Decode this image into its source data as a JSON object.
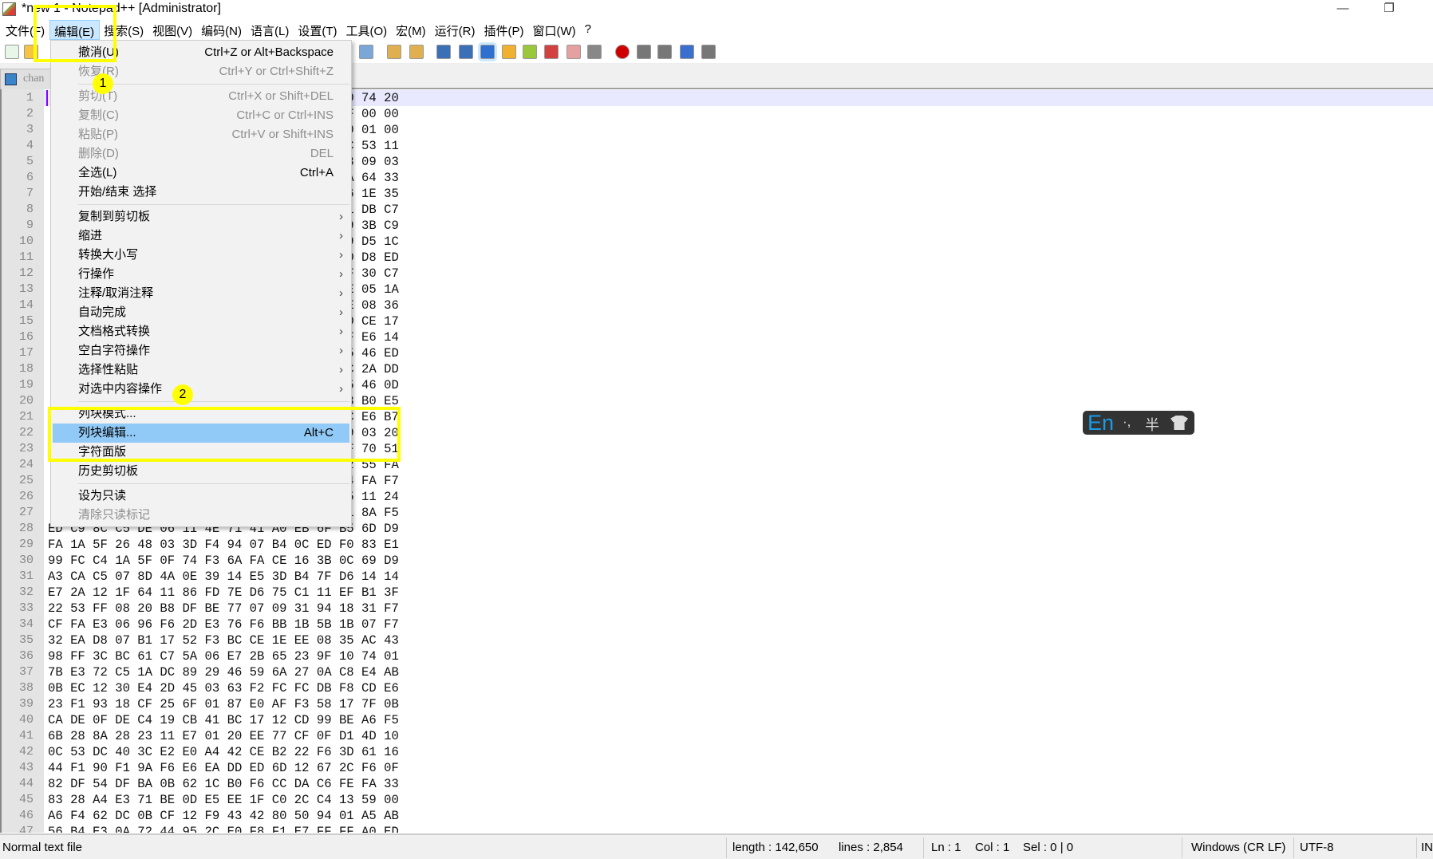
{
  "window": {
    "title": "*new 1 - Notepad++ [Administrator]",
    "minimize": "—",
    "restore": "❐"
  },
  "menubar": [
    "文件(F)",
    "编辑(E)",
    "搜索(S)",
    "视图(V)",
    "编码(N)",
    "语言(L)",
    "设置(T)",
    "工具(O)",
    "宏(M)",
    "运行(R)",
    "插件(P)",
    "窗口(W)",
    "?"
  ],
  "toolbar_icons": [
    {
      "name": "new-file",
      "color": "#e8f5e9"
    },
    {
      "name": "open-file",
      "color": "#f6c343"
    },
    {
      "name": "zoom-out",
      "color": "#7aa7d8"
    },
    {
      "name": "sync-vertical",
      "color": "#e0b050"
    },
    {
      "name": "sync-horizontal",
      "color": "#e0b050"
    },
    {
      "name": "word-wrap",
      "color": "#3b6fb6"
    },
    {
      "name": "show-all-chars",
      "color": "#3b6fb6"
    },
    {
      "name": "indent-guide",
      "color": "#2f6fd0"
    },
    {
      "name": "document-map",
      "color": "#f0b030"
    },
    {
      "name": "function-list",
      "color": "#9bc83b"
    },
    {
      "name": "folder-workspace",
      "color": "#d24040"
    },
    {
      "name": "monitoring",
      "color": "#e5a0a0"
    },
    {
      "name": "record-macro-disabled",
      "color": "#888888"
    },
    {
      "name": "record-macro",
      "color": "#d00000"
    },
    {
      "name": "stop-recording",
      "color": "#777777"
    },
    {
      "name": "play-macro",
      "color": "#777777"
    },
    {
      "name": "run-macro-multiple",
      "color": "#3a6fd0"
    },
    {
      "name": "save-macro",
      "color": "#777777"
    }
  ],
  "tab": {
    "label": "chan"
  },
  "editor": {
    "current_line": 1,
    "rows": [
      {
        "n": "1",
        "hex": "                                       6D 74 20"
      },
      {
        "n": "2",
        "hex": "                                       0F 00 00"
      },
      {
        "n": "3",
        "hex": "                                       00 01 00"
      },
      {
        "n": "4",
        "hex": "                                       0C 53 11"
      },
      {
        "n": "5",
        "hex": "                                       33 09 03"
      },
      {
        "n": "6",
        "hex": "                                       0A 64 33"
      },
      {
        "n": "7",
        "hex": "                                       16 1E 35"
      },
      {
        "n": "8",
        "hex": "                                       11 DB C7"
      },
      {
        "n": "9",
        "hex": "                                       F9 3B C9"
      },
      {
        "n": "10",
        "hex": "                                       09 D5 1C"
      },
      {
        "n": "11",
        "hex": "                                       DD D8 ED"
      },
      {
        "n": "12",
        "hex": "                                       AF 30 C7"
      },
      {
        "n": "13",
        "hex": "                                       0E 05 1A"
      },
      {
        "n": "14",
        "hex": "                                       3E 08 36"
      },
      {
        "n": "15",
        "hex": "                                       ED CE 17"
      },
      {
        "n": "16",
        "hex": "                                       FF E6 14"
      },
      {
        "n": "17",
        "hex": "                                       45 46 ED"
      },
      {
        "n": "18",
        "hex": "                                       0C 2A DD"
      },
      {
        "n": "19",
        "hex": "                                       D5 46 0D"
      },
      {
        "n": "20",
        "hex": "                                       E3 B0 E5"
      },
      {
        "n": "21",
        "hex": "                                       DC E6 B7"
      },
      {
        "n": "22",
        "hex": "                                       F9 03 20"
      },
      {
        "n": "23",
        "hex": "                                       1F 70 51"
      },
      {
        "n": "24",
        "hex": "                                       F2 55 FA"
      },
      {
        "n": "25",
        "hex": "                                       04 FA F7"
      },
      {
        "n": "26",
        "hex": "                                       55 11 24"
      },
      {
        "n": "27",
        "hex": "                                       11 8A F5"
      },
      {
        "n": "28",
        "hex": "ED C9 8C C5 DE 06 11 4E 71 41 A0 EB 6F B5 6D D9"
      },
      {
        "n": "29",
        "hex": "FA 1A 5F 26 48 03 3D F4 94 07 B4 0C ED F0 83 E1"
      },
      {
        "n": "30",
        "hex": "99 FC C4 1A 5F 0F 74 F3 6A FA CE 16 3B 0C 69 D9"
      },
      {
        "n": "31",
        "hex": "A3 CA C5 07 8D 4A 0E 39 14 E5 3D B4 7F D6 14 14"
      },
      {
        "n": "32",
        "hex": "E7 2A 12 1F 64 11 86 FD 7E D6 75 C1 11 EF B1 3F"
      },
      {
        "n": "33",
        "hex": "22 53 FF 08 20 B8 DF BE 77 07 09 31 94 18 31 F7"
      },
      {
        "n": "34",
        "hex": "CF FA E3 06 96 F6 2D E3 76 F6 BB 1B 5B 1B 07 F7"
      },
      {
        "n": "35",
        "hex": "32 EA D8 07 B1 17 52 F3 BC CE 1E EE 08 35 AC 43"
      },
      {
        "n": "36",
        "hex": "98 FF 3C BC 61 C7 5A 06 E7 2B 65 23 9F 10 74 01"
      },
      {
        "n": "37",
        "hex": "7B E3 72 C5 1A DC 89 29 46 59 6A 27 0A C8 E4 AB"
      },
      {
        "n": "38",
        "hex": "0B EC 12 30 E4 2D 45 03 63 F2 FC FC DB F8 CD E6"
      },
      {
        "n": "39",
        "hex": "23 F1 93 18 CF 25 6F 01 87 E0 AF F3 58 17 7F 0B"
      },
      {
        "n": "40",
        "hex": "CA DE 0F DE C4 19 CB 41 BC 17 12 CD 99 BE A6 F5"
      },
      {
        "n": "41",
        "hex": "6B 28 8A 28 23 11 E7 01 20 EE 77 CF 0F D1 4D 10"
      },
      {
        "n": "42",
        "hex": "0C 53 DC 40 3C E2 E0 A4 42 CE B2 22 F6 3D 61 16"
      },
      {
        "n": "43",
        "hex": "44 F1 90 F1 9A F6 E6 EA DD ED 6D 12 67 2C F6 0F"
      },
      {
        "n": "44",
        "hex": "82 DF 54 DF BA 0B 62 1C B0 F6 CC DA C6 FE FA 33"
      },
      {
        "n": "45",
        "hex": "83 28 A4 E3 71 BE 0D E5 EE 1F C0 2C C4 13 59 00"
      },
      {
        "n": "46",
        "hex": "A6 F4 62 DC 0B CF 12 F9 43 42 80 50 94 01 A5 AB"
      },
      {
        "n": "47",
        "hex": "56 B4 E3 0A 72 44 95 2C E0 F8 F1 E7 FF FF A0 ED"
      }
    ]
  },
  "edit_menu": [
    {
      "label": "撤消(U)",
      "shortcut": "Ctrl+Z or Alt+Backspace",
      "disabled": false
    },
    {
      "label": "恢复(R)",
      "shortcut": "Ctrl+Y or Ctrl+Shift+Z",
      "disabled": true
    },
    {
      "sep": true
    },
    {
      "label": "剪切(T)",
      "shortcut": "Ctrl+X or Shift+DEL",
      "disabled": true
    },
    {
      "label": "复制(C)",
      "shortcut": "Ctrl+C or Ctrl+INS",
      "disabled": true
    },
    {
      "label": "粘贴(P)",
      "shortcut": "Ctrl+V or Shift+INS",
      "disabled": true
    },
    {
      "label": "删除(D)",
      "shortcut": "DEL",
      "disabled": true
    },
    {
      "label": "全选(L)",
      "shortcut": "Ctrl+A",
      "disabled": false
    },
    {
      "label": "开始/结束 选择",
      "shortcut": "",
      "disabled": false
    },
    {
      "sep": true
    },
    {
      "label": "复制到剪切板",
      "submenu": true
    },
    {
      "label": "缩进",
      "submenu": true
    },
    {
      "label": "转换大小写",
      "submenu": true
    },
    {
      "label": "行操作",
      "submenu": true
    },
    {
      "label": "注释/取消注释",
      "submenu": true
    },
    {
      "label": "自动完成",
      "submenu": true
    },
    {
      "label": "文档格式转换",
      "submenu": true
    },
    {
      "label": "空白字符操作",
      "submenu": true
    },
    {
      "label": "选择性粘贴",
      "submenu": true
    },
    {
      "label": "对选中内容操作",
      "submenu": true
    },
    {
      "sep": true
    },
    {
      "label": "列块模式...",
      "shortcut": ""
    },
    {
      "label": "列块编辑...",
      "shortcut": "Alt+C",
      "highlighted": true
    },
    {
      "label": "字符面版",
      "shortcut": ""
    },
    {
      "label": "历史剪切板",
      "shortcut": ""
    },
    {
      "sep": true
    },
    {
      "label": "设为只读",
      "shortcut": ""
    },
    {
      "label": "清除只读标记",
      "shortcut": "",
      "disabled": true
    }
  ],
  "submenu_arrow": "›",
  "annotations": {
    "step1": "1",
    "step2": "2",
    "highlight_color": "#ffff00"
  },
  "ime": {
    "mode": "En",
    "punct": "·,",
    "width": "半"
  },
  "statusbar": {
    "file_type": "Normal text file",
    "length": "length : 142,650",
    "lines": "lines : 2,854",
    "ln": "Ln : 1",
    "col": "Col : 1",
    "sel": "Sel : 0 | 0",
    "eol": "Windows (CR LF)",
    "encoding": "UTF-8",
    "insert_mode": "IN"
  }
}
